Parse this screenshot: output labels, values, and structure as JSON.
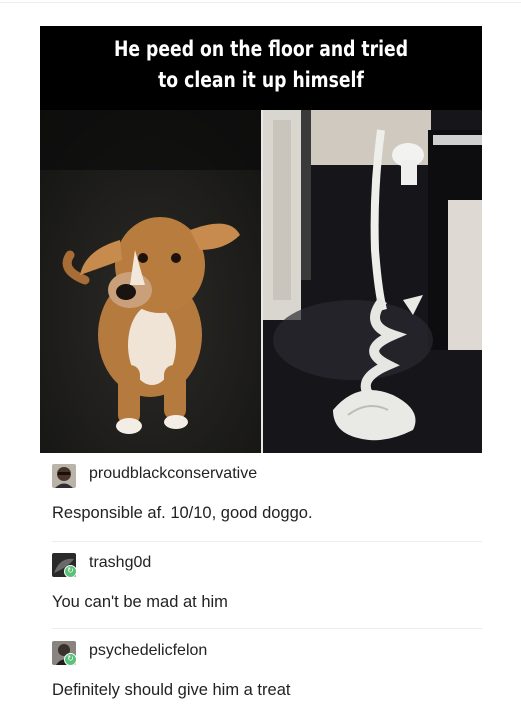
{
  "post": {
    "caption_line1": "He peed on the floor and tried",
    "caption_line2": "to clean it up himself",
    "colors": {
      "caption_bg": "#000000",
      "caption_text": "#ffffff",
      "dog": "#b57a3e",
      "tissue": "#e9e9e6"
    }
  },
  "comments": [
    {
      "username": "proudblackconservative",
      "text": "Responsible af. 10/10, good doggo.",
      "reblog_badge": false
    },
    {
      "username": "trashg0d",
      "text": "You can't be mad at him",
      "reblog_badge": true
    },
    {
      "username": "psychedelicfelon",
      "text": "Definitely should give him a treat",
      "reblog_badge": true
    }
  ],
  "icons": {
    "reblog_badge": "reblog-icon"
  }
}
